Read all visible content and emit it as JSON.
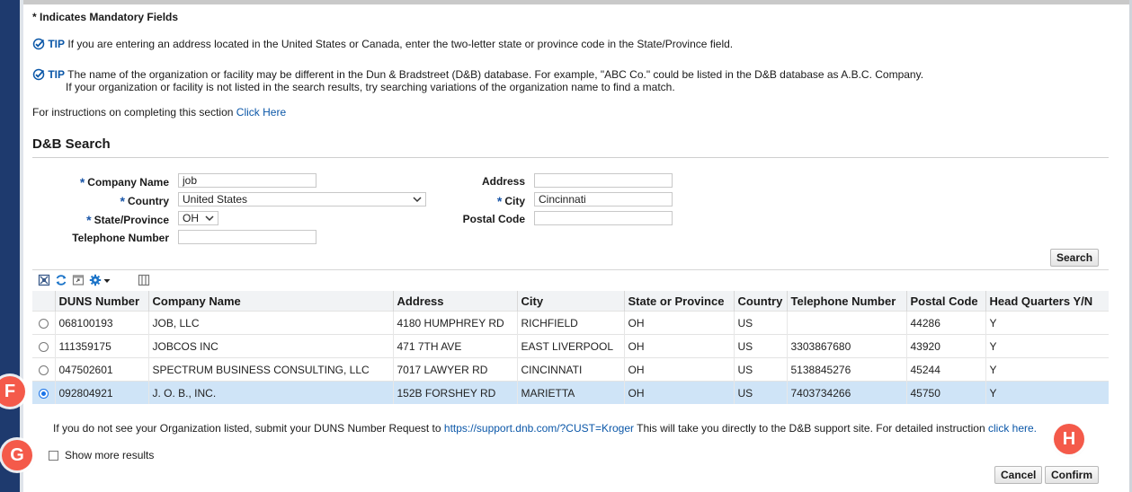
{
  "mandatory_note": "* Indicates Mandatory Fields",
  "tips": [
    {
      "label": "TIP",
      "lines": [
        "If you are entering an address located in the United States or Canada, enter the two-letter state or province code in the State/Province field."
      ]
    },
    {
      "label": "TIP",
      "lines": [
        "The name of the organization or facility may be different in the Dun & Bradstreet (D&B) database. For example, \"ABC Co.\" could be listed in the D&B database as A.B.C. Company.",
        "If your organization or facility is not listed in the search results, try searching variations of the organization name to find a match."
      ]
    }
  ],
  "instructions": {
    "text": "For instructions on completing this section",
    "link": "Click Here"
  },
  "section_title": "D&B Search",
  "form": {
    "company_name": {
      "label": "Company Name",
      "value": "job"
    },
    "country": {
      "label": "Country",
      "value": "United States"
    },
    "state": {
      "label": "State/Province",
      "value": "OH"
    },
    "telephone": {
      "label": "Telephone Number",
      "value": ""
    },
    "address": {
      "label": "Address",
      "value": ""
    },
    "city": {
      "label": "City",
      "value": "Cincinnati"
    },
    "postal_code": {
      "label": "Postal Code",
      "value": ""
    },
    "required_marker": "*"
  },
  "search_button": "Search",
  "table": {
    "headers": [
      "DUNS Number",
      "Company Name",
      "Address",
      "City",
      "State or Province",
      "Country",
      "Telephone Number",
      "Postal Code",
      "Head Quarters Y/N"
    ],
    "rows": [
      {
        "selected": false,
        "cells": [
          "068100193",
          "JOB, LLC",
          "4180 HUMPHREY RD",
          "RICHFIELD",
          "OH",
          "US",
          "",
          "44286",
          "Y"
        ]
      },
      {
        "selected": false,
        "cells": [
          "111359175",
          "JOBCOS INC",
          "471 7TH AVE",
          "EAST LIVERPOOL",
          "OH",
          "US",
          "3303867680",
          "43920",
          "Y"
        ]
      },
      {
        "selected": false,
        "cells": [
          "047502601",
          "SPECTRUM BUSINESS CONSULTING, LLC",
          "7017 LAWYER RD",
          "CINCINNATI",
          "OH",
          "US",
          "5138845276",
          "45244",
          "Y"
        ]
      },
      {
        "selected": true,
        "cells": [
          "092804921",
          "J. O. B., INC.",
          "152B FORSHEY RD",
          "MARIETTA",
          "OH",
          "US",
          "7403734266",
          "45750",
          "Y"
        ]
      }
    ]
  },
  "footer_note": {
    "before": "If you do not see your Organization listed, submit your DUNS Number Request to",
    "link": "https://support.dnb.com/?CUST=Kroger",
    "after": "This will take you directly to the D&B support site. For detailed instruction",
    "link2": "click here."
  },
  "show_more": "Show more results",
  "buttons": {
    "cancel": "Cancel",
    "confirm": "Confirm"
  },
  "callouts": {
    "f": "F",
    "g": "G",
    "h": "H"
  },
  "colors": {
    "tip_blue": "#0b57a8",
    "selected_row": "#cfe4f7",
    "callout_red": "#f45a4a",
    "sidebar": "#1e3a6e"
  }
}
